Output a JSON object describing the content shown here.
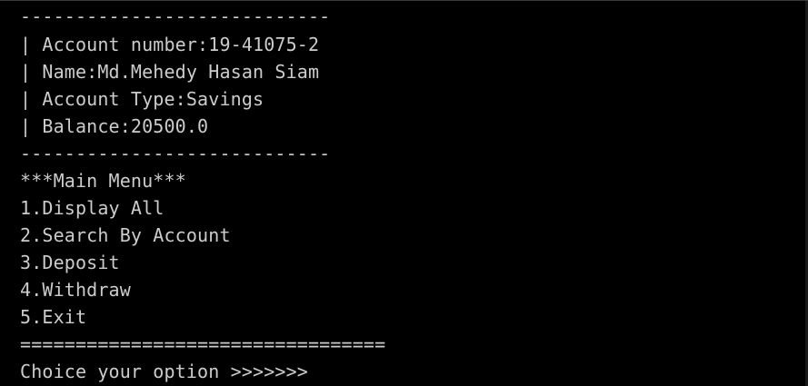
{
  "console": {
    "separator_top": "----------------------------",
    "account_number": "| Account number:19-41075-2",
    "name": "| Name:Md.Mehedy Hasan Siam",
    "account_type": "| Account Type:Savings",
    "balance": "| Balance:20500.0",
    "separator_bottom": "----------------------------",
    "menu_title": "***Main Menu***",
    "menu_items": [
      "1.Display All",
      "2.Search By Account",
      "3.Deposit",
      "4.Withdraw",
      "5.Exit"
    ],
    "double_separator": "=================================",
    "prompt": "Choice your option >>>>>>>"
  },
  "colors": {
    "background": "#000000",
    "text": "#cccccc"
  }
}
